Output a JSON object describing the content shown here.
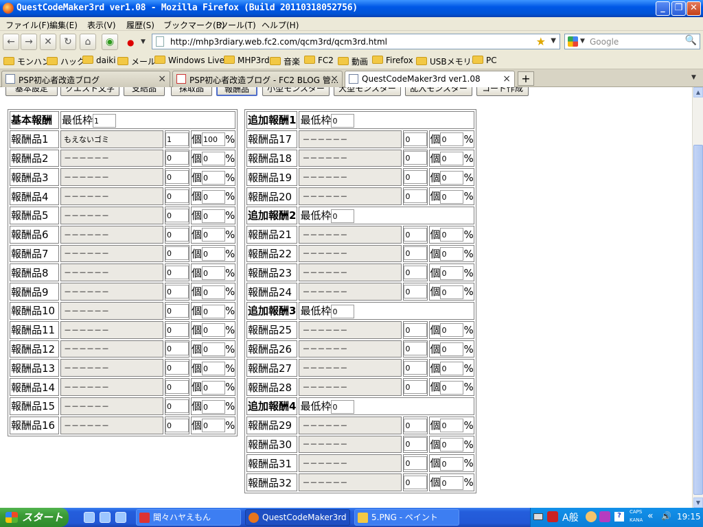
{
  "window": {
    "title": "QuestCodeMaker3rd ver1.08 - Mozilla Firefox (Build 20110318052756)"
  },
  "menu": [
    "ファイル(F)",
    "編集(E)",
    "表示(V)",
    "履歴(S)",
    "ブックマーク(B)",
    "ツール(T)",
    "ヘルプ(H)"
  ],
  "nav": {
    "url": "http://mhp3rdiary.web.fc2.com/qcm3rd/qcm3rd.html",
    "search_placeholder": "Google"
  },
  "bookmarks": [
    "モンハン",
    "ハック",
    "daiki",
    "メール",
    "Windows Live",
    "MHP3rd",
    "音楽",
    "FC2",
    "動画",
    "Firefox",
    "USBメモリー",
    "PC"
  ],
  "tabs": [
    "PSP初心者改造ブログ",
    "PSP初心者改造ブログ - FC2 BLOG 管...",
    "QuestCodeMaker3rd ver1.08"
  ],
  "toolbar_buttons": [
    "基本設定",
    "クエスト文字",
    "支給品",
    "採取品",
    "報酬品",
    "小型モンスター",
    "大型モンスター",
    "乱入モンスター",
    "コード作成"
  ],
  "labels": {
    "min_slot": "最低枠",
    "count_unit": "個",
    "percent": "%"
  },
  "left_table": {
    "header": {
      "label": "基本報酬",
      "min_value": "1"
    },
    "rows": [
      {
        "label": "報酬品1",
        "item": "もえないゴミ",
        "count": "1",
        "pct": "100"
      },
      {
        "label": "報酬品2",
        "item": "－－－－－－",
        "count": "0",
        "pct": "0"
      },
      {
        "label": "報酬品3",
        "item": "－－－－－－",
        "count": "0",
        "pct": "0"
      },
      {
        "label": "報酬品4",
        "item": "－－－－－－",
        "count": "0",
        "pct": "0"
      },
      {
        "label": "報酬品5",
        "item": "－－－－－－",
        "count": "0",
        "pct": "0"
      },
      {
        "label": "報酬品6",
        "item": "－－－－－－",
        "count": "0",
        "pct": "0"
      },
      {
        "label": "報酬品7",
        "item": "－－－－－－",
        "count": "0",
        "pct": "0"
      },
      {
        "label": "報酬品8",
        "item": "－－－－－－",
        "count": "0",
        "pct": "0"
      },
      {
        "label": "報酬品9",
        "item": "－－－－－－",
        "count": "0",
        "pct": "0"
      },
      {
        "label": "報酬品10",
        "item": "－－－－－－",
        "count": "0",
        "pct": "0"
      },
      {
        "label": "報酬品11",
        "item": "－－－－－－",
        "count": "0",
        "pct": "0"
      },
      {
        "label": "報酬品12",
        "item": "－－－－－－",
        "count": "0",
        "pct": "0"
      },
      {
        "label": "報酬品13",
        "item": "－－－－－－",
        "count": "0",
        "pct": "0"
      },
      {
        "label": "報酬品14",
        "item": "－－－－－－",
        "count": "0",
        "pct": "0"
      },
      {
        "label": "報酬品15",
        "item": "－－－－－－",
        "count": "0",
        "pct": "0"
      },
      {
        "label": "報酬品16",
        "item": "－－－－－－",
        "count": "0",
        "pct": "0"
      }
    ]
  },
  "right_table": {
    "groups": [
      {
        "label": "追加報酬1",
        "min_value": "0",
        "rows": [
          {
            "label": "報酬品17",
            "item": "－－－－－－",
            "count": "0",
            "pct": "0"
          },
          {
            "label": "報酬品18",
            "item": "－－－－－－",
            "count": "0",
            "pct": "0"
          },
          {
            "label": "報酬品19",
            "item": "－－－－－－",
            "count": "0",
            "pct": "0"
          },
          {
            "label": "報酬品20",
            "item": "－－－－－－",
            "count": "0",
            "pct": "0"
          }
        ]
      },
      {
        "label": "追加報酬2",
        "min_value": "0",
        "rows": [
          {
            "label": "報酬品21",
            "item": "－－－－－－",
            "count": "0",
            "pct": "0"
          },
          {
            "label": "報酬品22",
            "item": "－－－－－－",
            "count": "0",
            "pct": "0"
          },
          {
            "label": "報酬品23",
            "item": "－－－－－－",
            "count": "0",
            "pct": "0"
          },
          {
            "label": "報酬品24",
            "item": "－－－－－－",
            "count": "0",
            "pct": "0"
          }
        ]
      },
      {
        "label": "追加報酬3",
        "min_value": "0",
        "rows": [
          {
            "label": "報酬品25",
            "item": "－－－－－－",
            "count": "0",
            "pct": "0"
          },
          {
            "label": "報酬品26",
            "item": "－－－－－－",
            "count": "0",
            "pct": "0"
          },
          {
            "label": "報酬品27",
            "item": "－－－－－－",
            "count": "0",
            "pct": "0"
          },
          {
            "label": "報酬品28",
            "item": "－－－－－－",
            "count": "0",
            "pct": "0"
          }
        ]
      },
      {
        "label": "追加報酬4",
        "min_value": "0",
        "rows": [
          {
            "label": "報酬品29",
            "item": "－－－－－－",
            "count": "0",
            "pct": "0"
          },
          {
            "label": "報酬品30",
            "item": "－－－－－－",
            "count": "0",
            "pct": "0"
          },
          {
            "label": "報酬品31",
            "item": "－－－－－－",
            "count": "0",
            "pct": "0"
          },
          {
            "label": "報酬品32",
            "item": "－－－－－－",
            "count": "0",
            "pct": "0"
          }
        ]
      }
    ]
  },
  "taskbar": {
    "start": "スタート",
    "tasks": [
      "聞々ハヤえもん",
      "QuestCodeMaker3rd ...",
      "5.PNG - ペイント"
    ],
    "tray": {
      "ime": "A般",
      "caps": "CAPS",
      "kana": "KANA",
      "time": "19:15"
    }
  }
}
